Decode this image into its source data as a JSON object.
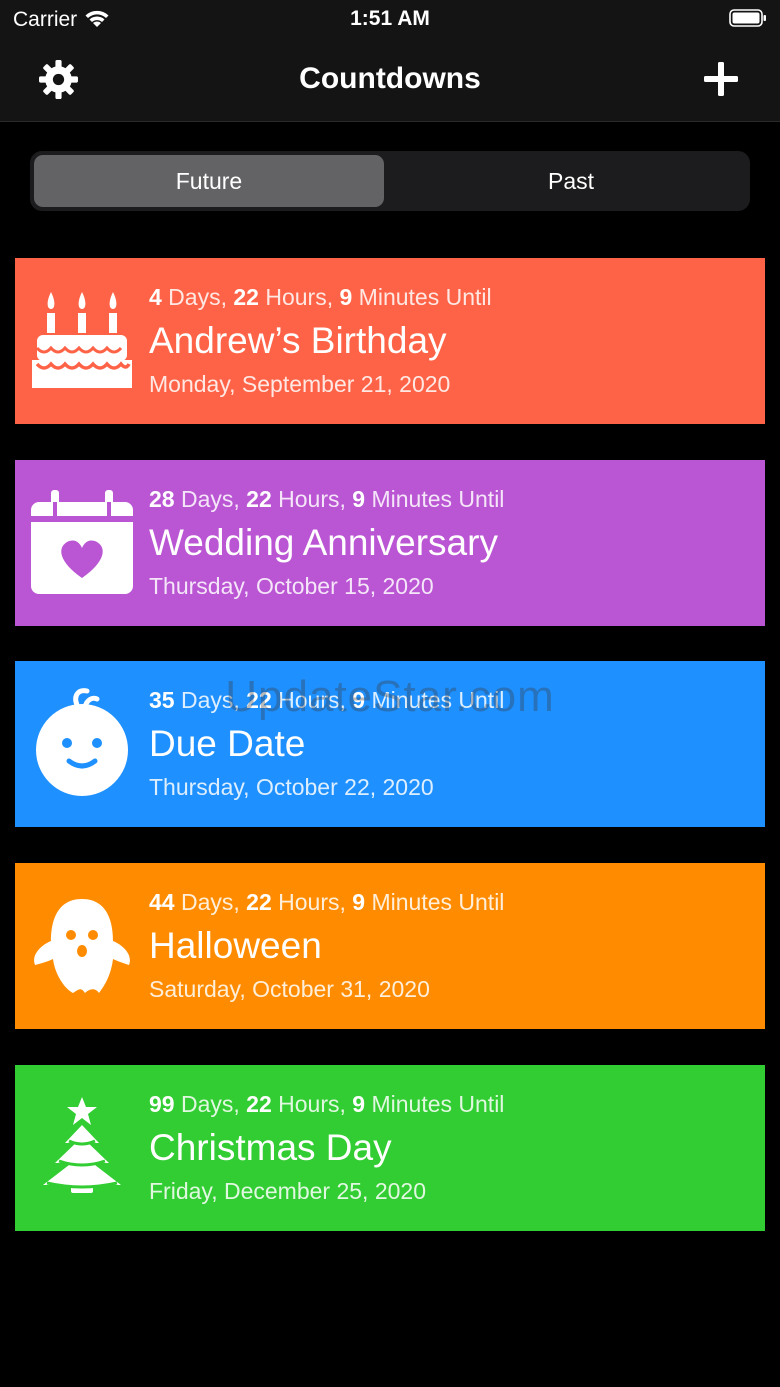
{
  "status_bar": {
    "carrier": "Carrier",
    "time": "1:51 AM"
  },
  "nav": {
    "title": "Countdowns",
    "settings_icon": "gear-icon",
    "add_icon": "plus-icon"
  },
  "segments": [
    {
      "label": "Future",
      "selected": true
    },
    {
      "label": "Past",
      "selected": false
    }
  ],
  "countdowns": [
    {
      "days": "4",
      "hours": "22",
      "minutes": "9",
      "days_label": " Days, ",
      "hours_label": " Hours, ",
      "minutes_label": " Minutes Until",
      "title": "Andrew’s Birthday",
      "date": "Monday, September 21, 2020",
      "color": "#ff6347",
      "icon": "birthday-cake-icon"
    },
    {
      "days": "28",
      "hours": "22",
      "minutes": "9",
      "days_label": " Days, ",
      "hours_label": " Hours, ",
      "minutes_label": " Minutes Until",
      "title": "Wedding Anniversary",
      "date": "Thursday, October 15, 2020",
      "color": "#ba55d3",
      "icon": "calendar-heart-icon"
    },
    {
      "days": "35",
      "hours": "22",
      "minutes": "9",
      "days_label": " Days, ",
      "hours_label": " Hours, ",
      "minutes_label": " Minutes Until",
      "title": "Due Date",
      "date": "Thursday, October 22, 2020",
      "color": "#1e90ff",
      "icon": "baby-face-icon"
    },
    {
      "days": "44",
      "hours": "22",
      "minutes": "9",
      "days_label": " Days, ",
      "hours_label": " Hours, ",
      "minutes_label": " Minutes Until",
      "title": "Halloween",
      "date": "Saturday, October 31, 2020",
      "color": "#ff8c00",
      "icon": "ghost-icon"
    },
    {
      "days": "99",
      "hours": "22",
      "minutes": "9",
      "days_label": " Days, ",
      "hours_label": " Hours, ",
      "minutes_label": " Minutes Until",
      "title": "Christmas Day",
      "date": "Friday, December 25, 2020",
      "color": "#32cd32",
      "icon": "christmas-tree-icon"
    }
  ],
  "watermark": "UpdateStar.com"
}
